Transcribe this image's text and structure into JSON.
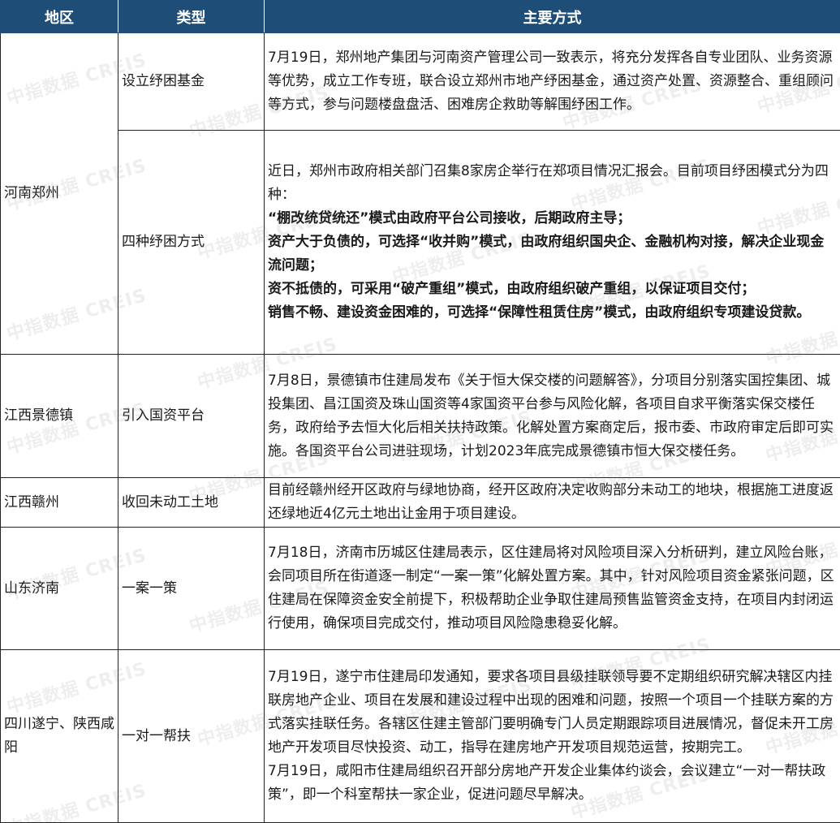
{
  "header": {
    "region": "地区",
    "type": "类型",
    "method": "主要方式"
  },
  "rows": [
    {
      "region": "河南郑州",
      "type": "设立纾困基金",
      "paragraphs": [
        {
          "text": "7月19日，郑州地产集团与河南资产管理公司一致表示，将充分发挥各自专业团队、业务资源等优势，成立工作专班，联合设立郑州市地产纾困基金，通过资产处置、资源整合、重组顾问等方式，参与问题楼盘盘活、困难房企救助等解围纾困工作。",
          "bold": false
        }
      ]
    },
    {
      "region": "",
      "type": "四种纾困方式",
      "paragraphs": [
        {
          "text": "近日，郑州市政府相关部门召集8家房企举行在郑项目情况汇报会。目前项目纾困模式分为四种：",
          "bold": false
        },
        {
          "text": "“棚改统贷统还”模式由政府平台公司接收，后期政府主导；",
          "bold": true
        },
        {
          "text": "资产大于负债的，可选择“收并购”模式，由政府组织国央企、金融机构对接，解决企业现金流问题；",
          "bold": true
        },
        {
          "text": "资不抵债的，可采用“破产重组”模式，由政府组织破产重组，以保证项目交付；",
          "bold": true
        },
        {
          "text": "销售不畅、建设资金困难的，可选择“保障性租赁住房”模式，由政府组织专项建设贷款。",
          "bold": true
        }
      ]
    },
    {
      "region": "江西景德镇",
      "type": "引入国资平台",
      "paragraphs": [
        {
          "text": "7月8日，景德镇市住建局发布《关于恒大保交楼的问题解答》，分项目分别落实国控集团、城投集团、昌江国资及珠山国资等4家国资平台参与风险化解，各项目自求平衡落实保交楼任务，政府给予去恒大化后相关扶持政策。化解处置方案商定后，报市委、市政府审定后即可实施。各国资平台公司进驻现场，计划2023年底完成景德镇市恒大保交楼任务。",
          "bold": false
        }
      ]
    },
    {
      "region": "江西赣州",
      "type": "收回未动工土地",
      "paragraphs": [
        {
          "text": "目前经赣州经开区政府与绿地协商，经开区政府决定收购部分未动工的地块，根据施工进度返还绿地近4亿元土地出让金用于项目建设。",
          "bold": false
        }
      ]
    },
    {
      "region": "山东济南",
      "type": "一案一策",
      "paragraphs": [
        {
          "text": "7月18日，济南市历城区住建局表示，区住建局将对风险项目深入分析研判，建立风险台账，会同项目所在街道逐一制定“一案一策”化解处置方案。其中，针对风险项目资金紧张问题，区住建局在保障资金安全前提下，积极帮助企业争取住建局预售监管资金支持，在项目内封闭运行使用，确保项目完成交付，推动项目风险隐患稳妥化解。",
          "bold": false
        }
      ]
    },
    {
      "region": "四川遂宁、陕西咸阳",
      "type": "一对一帮扶",
      "paragraphs": [
        {
          "text": "7月19日，遂宁市住建局印发通知，要求各项目县级挂联领导要不定期组织研究解决辖区内挂联房地产企业、项目在发展和建设过程中出现的困难和问题，按照一个项目一个挂联方案的方式落实挂联任务。各辖区住建主管部门要明确专门人员定期跟踪项目进展情况，督促未开工房地产开发项目尽快投资、动工，指导在建房地产开发项目规范运营，按期完工。",
          "bold": false
        },
        {
          "text": "7月19日，咸阳市住建局组织召开部分房地产开发企业集体约谈会，会议建立“一对一帮扶政策”，即一个科室帮扶一家企业，促进问题尽早解决。",
          "bold": false
        }
      ]
    }
  ],
  "watermark": "中指数据 CREIS",
  "colors": {
    "header_bg": "#1e4d78",
    "header_text": "#ffffff",
    "border": "#222222"
  }
}
